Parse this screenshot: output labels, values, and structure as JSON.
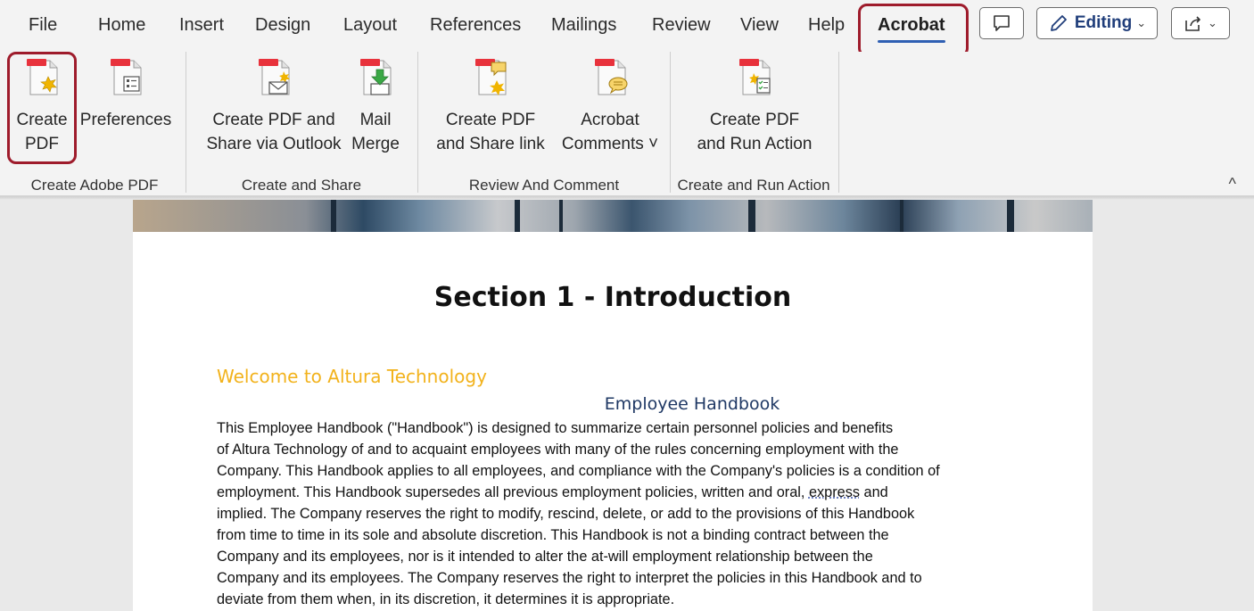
{
  "menu": {
    "tabs": [
      {
        "label": "File"
      },
      {
        "label": "Home"
      },
      {
        "label": "Insert"
      },
      {
        "label": "Design"
      },
      {
        "label": "Layout"
      },
      {
        "label": "References"
      },
      {
        "label": "Mailings"
      },
      {
        "label": "Review"
      },
      {
        "label": "View"
      },
      {
        "label": "Help"
      },
      {
        "label": "Acrobat"
      }
    ],
    "active_tab": "Acrobat",
    "editing_label": "Editing"
  },
  "ribbon": {
    "groups": [
      {
        "label": "Create Adobe PDF",
        "buttons": [
          {
            "line1": "Create",
            "line2": "PDF",
            "icon": "create-pdf-icon"
          },
          {
            "line1": "Preferences",
            "line2": "",
            "icon": "preferences-icon"
          }
        ]
      },
      {
        "label": "Create and Share",
        "buttons": [
          {
            "line1": "Create PDF and",
            "line2": "Share via Outlook",
            "icon": "share-outlook-icon"
          },
          {
            "line1": "Mail",
            "line2": "Merge",
            "icon": "mail-merge-icon"
          }
        ]
      },
      {
        "label": "Review And Comment",
        "buttons": [
          {
            "line1": "Create PDF",
            "line2": "and Share link",
            "icon": "share-link-icon"
          },
          {
            "line1": "Acrobat",
            "line2": "Comments ˅",
            "icon": "comments-icon"
          }
        ]
      },
      {
        "label": "Create and Run Action",
        "buttons": [
          {
            "line1": "Create PDF",
            "line2": "and Run Action",
            "icon": "run-action-icon"
          }
        ]
      }
    ],
    "collapse_glyph": "^"
  },
  "document": {
    "title": "Section 1 - Introduction",
    "welcome": "Welcome to Altura Technology",
    "subheading": "Employee Handbook",
    "body_lines": [
      "This Employee Handbook (\"Handbook\") is designed to summarize certain personnel policies and benefits",
      "of Altura Technology of and to acquaint employees with many of the rules concerning employment with the",
      "Company. This Handbook applies to all employees, and compliance with the Company's policies is a condition of",
      "employment. This Handbook supersedes all previous employment policies, written and oral,",
      "implied. The Company reserves the right to modify, rescind, delete, or add to the provisions of this Handbook",
      "from time to time in its sole and absolute discretion. This Handbook is not a binding contract between the",
      "Company and its employees, nor is it intended to alter the at-will employment relationship between the",
      "Company and its employees. The Company reserves the right to interpret the policies in this Handbook and to",
      "deviate from them when, in its discretion, it determines it is appropriate."
    ],
    "line4_squiggle_word": "express",
    "line4_tail": " and"
  },
  "colors": {
    "highlight": "#9e1b2b",
    "welcome": "#f2b21b",
    "subheading": "#1f3864",
    "active_tab_underline": "#2f5fb3"
  }
}
